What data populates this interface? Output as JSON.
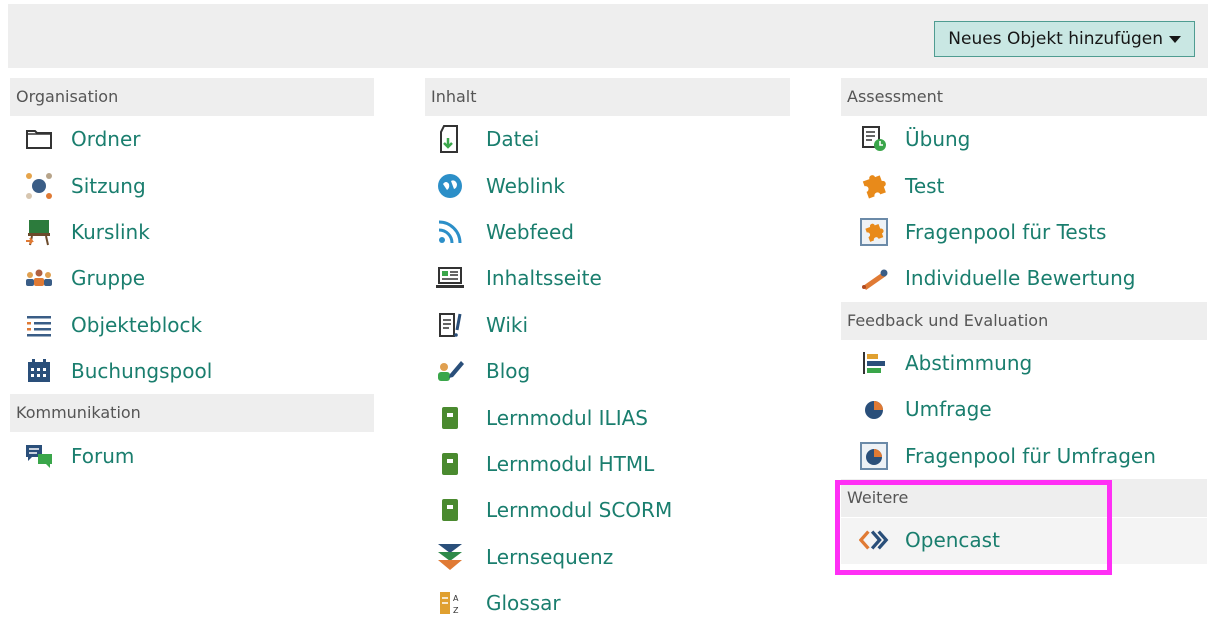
{
  "toolbar": {
    "add_button_label": "Neues Objekt hinzufügen"
  },
  "columns": [
    {
      "sections": [
        {
          "title": "Organisation",
          "items": [
            {
              "label": "Ordner",
              "icon": "folder-icon"
            },
            {
              "label": "Sitzung",
              "icon": "session-icon"
            },
            {
              "label": "Kurslink",
              "icon": "course-link-icon"
            },
            {
              "label": "Gruppe",
              "icon": "group-icon"
            },
            {
              "label": "Objekteblock",
              "icon": "list-block-icon"
            },
            {
              "label": "Buchungspool",
              "icon": "calendar-icon"
            }
          ]
        },
        {
          "title": "Kommunikation",
          "items": [
            {
              "label": "Forum",
              "icon": "forum-icon"
            }
          ]
        }
      ]
    },
    {
      "sections": [
        {
          "title": "Inhalt",
          "items": [
            {
              "label": "Datei",
              "icon": "file-icon"
            },
            {
              "label": "Weblink",
              "icon": "weblink-icon"
            },
            {
              "label": "Webfeed",
              "icon": "rss-icon"
            },
            {
              "label": "Inhaltsseite",
              "icon": "content-page-icon"
            },
            {
              "label": "Wiki",
              "icon": "wiki-icon"
            },
            {
              "label": "Blog",
              "icon": "blog-icon"
            },
            {
              "label": "Lernmodul ILIAS",
              "icon": "learning-module-icon"
            },
            {
              "label": "Lernmodul HTML",
              "icon": "learning-module-icon"
            },
            {
              "label": "Lernmodul SCORM",
              "icon": "learning-module-icon"
            },
            {
              "label": "Lernsequenz",
              "icon": "learning-sequence-icon"
            },
            {
              "label": "Glossar",
              "icon": "glossary-icon"
            }
          ]
        }
      ]
    },
    {
      "sections": [
        {
          "title": "Assessment",
          "items": [
            {
              "label": "Übung",
              "icon": "exercise-icon"
            },
            {
              "label": "Test",
              "icon": "test-icon"
            },
            {
              "label": "Fragenpool für Tests",
              "icon": "test-pool-icon"
            },
            {
              "label": "Individuelle Bewertung",
              "icon": "individual-assessment-icon"
            }
          ]
        },
        {
          "title": "Feedback und Evaluation",
          "items": [
            {
              "label": "Abstimmung",
              "icon": "poll-icon"
            },
            {
              "label": "Umfrage",
              "icon": "survey-icon"
            },
            {
              "label": "Fragenpool für Umfragen",
              "icon": "survey-pool-icon"
            }
          ]
        },
        {
          "title": "Weitere",
          "items": [
            {
              "label": "Opencast",
              "icon": "opencast-icon"
            }
          ]
        }
      ]
    }
  ],
  "colors": {
    "accent": "#1a7e6e",
    "highlight": "#ff2ff5",
    "button_bg": "#c9e7e3"
  }
}
